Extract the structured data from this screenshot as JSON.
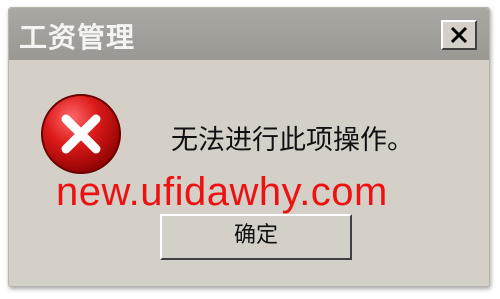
{
  "window": {
    "title": "工资管理"
  },
  "message": {
    "text": "无法进行此项操作。",
    "icon": "error-icon"
  },
  "buttons": {
    "ok_label": "确定",
    "close_icon": "close-icon"
  },
  "watermark": {
    "text": "new.ufidawhy.com",
    "color": "#ee1111"
  },
  "colors": {
    "dialog_background": "#d4d0c8",
    "title_bar": "#9a9892",
    "error_icon": "#c8102e"
  }
}
